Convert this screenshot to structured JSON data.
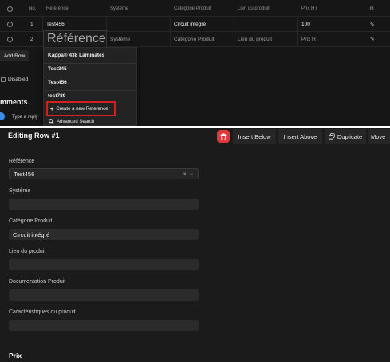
{
  "grid": {
    "headers": {
      "no": "No.",
      "reference": "Reference",
      "systeme": "Système",
      "categorie": "Catégorie Produit",
      "lien": "Lien du produit",
      "prix": "Prix HT"
    },
    "row1": {
      "no": "1",
      "reference": "Test456",
      "systeme": "",
      "categorie": "Circuit intégré",
      "lien": "",
      "prix": "100"
    },
    "row2": {
      "no": "2",
      "reference": "Référence",
      "systeme": "Système",
      "categorie": "Catégorie Produit",
      "lien": "Lien du produit",
      "prix": "Prix HT"
    }
  },
  "actions": {
    "add_row": "Add Row"
  },
  "side": {
    "disabled_label": "Disabled",
    "comments_title": "mments",
    "reply_placeholder": "Type a reply"
  },
  "dropdown": {
    "items": [
      "Kappa® 438 Laminates",
      "Test345",
      "Test456",
      "test789"
    ],
    "create_label": "Create a new Reference",
    "advanced_label": "Advanced Search",
    "highlight_color": "#d3201f"
  },
  "editor": {
    "title": "Editing Row #1",
    "buttons": {
      "insert_below": "Insert Below",
      "insert_above": "Insert Above",
      "duplicate": "Duplicate",
      "move": "Move"
    },
    "delete_color": "#e43838",
    "fields": {
      "reference_label": "Référence",
      "reference_value": "Test456",
      "systeme_label": "Système",
      "categorie_label": "Catégorie Produit",
      "categorie_value": "Circuit intégré",
      "lien_label": "Lien du produit",
      "documentation_label": "Documentation Produit",
      "caracteristiques_label": "Caractéristiques du produit"
    },
    "section_title": "Prix"
  }
}
